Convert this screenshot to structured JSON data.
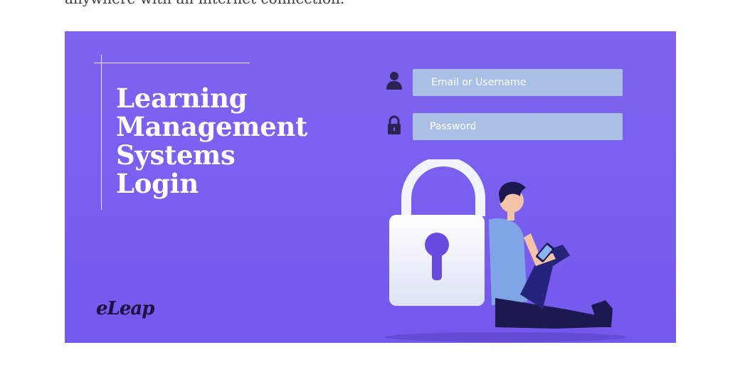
{
  "article": {
    "intro_text": "anywhere with an internet connection."
  },
  "hero": {
    "background_color": "#7a5eef",
    "title_lines": [
      "Learning",
      "Management",
      "Systems",
      "Login"
    ],
    "login_form": {
      "email_placeholder": "Email or Username",
      "password_placeholder": "Password",
      "field_color": "#a9bfe4"
    },
    "icons": {
      "email": "user-icon",
      "password": "lock-icon",
      "illustration": "padlock-person-illustration"
    },
    "brand_logo": "eLeap"
  }
}
